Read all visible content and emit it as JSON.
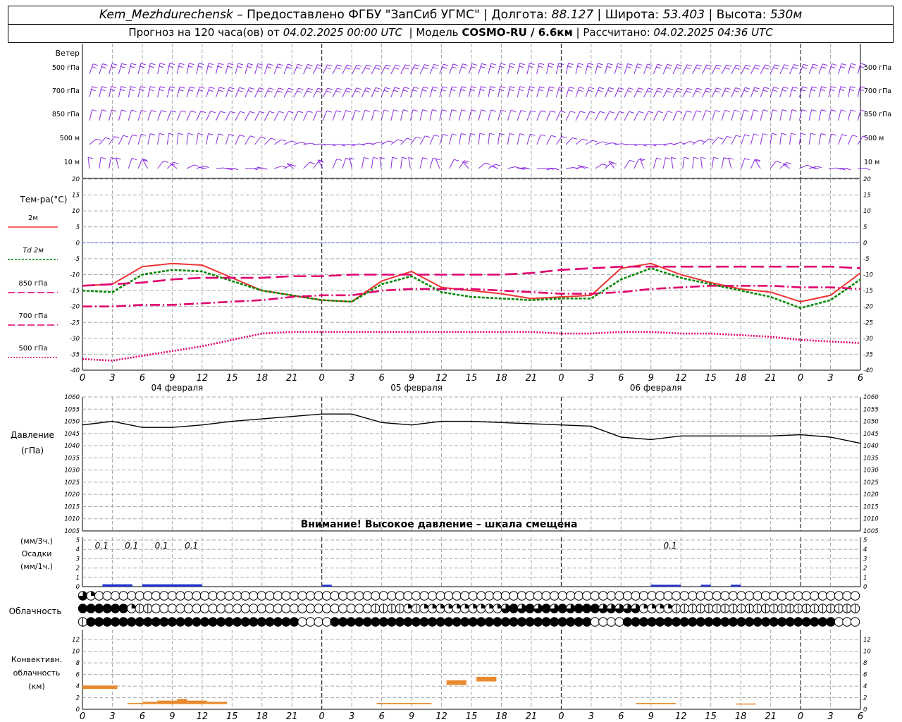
{
  "header": {
    "station": "Kem_Mezhdurechensk",
    "provider": "– Предоставлено ФГБУ \"ЗапСиб УГМС\"",
    "lon_label": "Долгота:",
    "lon": "88.127",
    "lat_label": "Широта:",
    "lat": "53.403",
    "alt_label": "Высота:",
    "alt": "530м",
    "forecast_label": "Прогноз на 120 часа(ов) от",
    "forecast_start": "04.02.2025 00:00 UTC",
    "model_label": "Модель",
    "model": "COSMO-RU / 6.6км",
    "calc_label": "Рассчитано:",
    "calc_time": "04.02.2025 04:36 UTC"
  },
  "chart_data": [
    {
      "type": "barbs",
      "title": "Ветер",
      "levels": [
        "500 гПа",
        "700 гПа",
        "850 гПа",
        "500 м",
        "10  м"
      ]
    },
    {
      "type": "line",
      "ylabel": "Тем-ра(°C)",
      "ylim": [
        -40,
        20
      ],
      "yticks": [
        20,
        15,
        10,
        5,
        0,
        -5,
        -10,
        -15,
        -20,
        -25,
        -30,
        -35,
        -40
      ],
      "x_ticks": [
        "0",
        "3",
        "6",
        "9",
        "12",
        "15",
        "18",
        "21",
        "0",
        "3",
        "6",
        "9",
        "12",
        "15",
        "18",
        "21",
        "0",
        "3",
        "6",
        "9",
        "12",
        "15",
        "18",
        "21",
        "0",
        "3",
        "6"
      ],
      "dates": [
        "04 февраля",
        "05 февраля",
        "06 февраля"
      ],
      "x_hours": [
        0,
        3,
        6,
        9,
        12,
        15,
        18,
        21,
        24,
        27,
        30,
        33,
        36,
        39,
        42,
        45,
        48,
        51,
        54,
        57,
        60,
        63,
        66,
        69,
        72,
        75,
        78
      ],
      "series": [
        {
          "name": "2м",
          "color": "#ee3333",
          "dash": "",
          "values": [
            -13.5,
            -13,
            -7.5,
            -6.5,
            -7,
            -11,
            -15,
            -16.5,
            -18,
            -18.5,
            -12,
            -9,
            -14,
            -15,
            -16,
            -17.5,
            -17,
            -16.5,
            -8,
            -6.5,
            -10,
            -12.5,
            -14.5,
            -15.5,
            -18.5,
            -16.5,
            -9.5
          ]
        },
        {
          "name": "Td  2м",
          "color": "#008800",
          "dash": "4,2",
          "values": [
            -15,
            -15.5,
            -10,
            -8.5,
            -9,
            -12,
            -15,
            -16.5,
            -18,
            -18.5,
            -13,
            -10.5,
            -15.5,
            -17,
            -17.5,
            -18,
            -17.5,
            -17.5,
            -11.5,
            -8,
            -11,
            -13,
            -15,
            -17,
            -20.5,
            -18,
            -11.5
          ]
        },
        {
          "name": "850 гПа",
          "color": "#e0006f",
          "dash": "18,7",
          "values": [
            -13.5,
            -13,
            -12.5,
            -11.5,
            -11,
            -11,
            -11,
            -10.5,
            -10.5,
            -10,
            -10,
            -10,
            -10,
            -10,
            -10,
            -9.5,
            -8.5,
            -8,
            -7.5,
            -7.5,
            -7.5,
            -7.5,
            -7.5,
            -7.5,
            -7.5,
            -7.5,
            -8
          ]
        },
        {
          "name": "700 гПа",
          "color": "#e0006f",
          "dash": "14,4,2,4",
          "values": [
            -20,
            -20,
            -19.5,
            -19.5,
            -19,
            -18.5,
            -18,
            -17,
            -16.5,
            -16.5,
            -15,
            -14.5,
            -14.5,
            -14.5,
            -15,
            -15.5,
            -16,
            -16,
            -15.5,
            -14.5,
            -14,
            -13.5,
            -13.5,
            -13.5,
            -14,
            -14,
            -14.5
          ]
        },
        {
          "name": "500 гПа",
          "color": "#e0006f",
          "dash": "2,2",
          "values": [
            -36.5,
            -37,
            -35.5,
            -34,
            -32.5,
            -30.5,
            -28.5,
            -28,
            -28,
            -28,
            -28,
            -28,
            -28,
            -28,
            -28,
            -28,
            -28.5,
            -28.5,
            -28,
            -28,
            -28.5,
            -28.5,
            -29,
            -29.5,
            -30.5,
            -31,
            -31.5
          ]
        }
      ]
    },
    {
      "type": "line",
      "ylabel": "Давление",
      "ylabel2": "(гПа)",
      "ylim": [
        1005,
        1060
      ],
      "yticks": [
        1060,
        1055,
        1050,
        1045,
        1040,
        1035,
        1030,
        1025,
        1020,
        1015,
        1010,
        1005
      ],
      "note": "Внимание! Высокое давление – шкала смещена",
      "x_hours": [
        0,
        3,
        6,
        9,
        12,
        15,
        18,
        21,
        24,
        27,
        30,
        33,
        36,
        39,
        42,
        45,
        48,
        51,
        54,
        57,
        60,
        63,
        66,
        69,
        72,
        75,
        78
      ],
      "values": [
        1048.5,
        1050,
        1047.5,
        1047.5,
        1048.5,
        1050,
        1051,
        1052,
        1053,
        1053,
        1049.5,
        1048.5,
        1050,
        1050,
        1049.5,
        1049,
        1048.5,
        1048,
        1043.5,
        1042.5,
        1044,
        1044,
        1044,
        1044,
        1044.5,
        1043.5,
        1041
      ]
    },
    {
      "type": "bar",
      "ylabel": "(мм/3ч.)",
      "ylabel2": "Осадки",
      "ylabel3": "(мм/1ч.)",
      "ylim": [
        0,
        5
      ],
      "yticks": [
        5,
        4,
        3,
        2,
        1,
        0
      ],
      "labels": [
        {
          "hour": 1.5,
          "text": "0.1"
        },
        {
          "hour": 4.5,
          "text": "0.1"
        },
        {
          "hour": 7.5,
          "text": "0.1"
        },
        {
          "hour": 10.5,
          "text": "0.1"
        },
        {
          "hour": 58.5,
          "text": "0.1"
        }
      ],
      "bars": [
        {
          "from": 2,
          "to": 5,
          "value": 0.1
        },
        {
          "from": 6,
          "to": 12,
          "value": 0.1
        },
        {
          "from": 24,
          "to": 25,
          "value": 0.05
        },
        {
          "from": 57,
          "to": 60,
          "value": 0.05
        },
        {
          "from": 62,
          "to": 63,
          "value": 0.05
        },
        {
          "from": 65,
          "to": 66,
          "value": 0.05
        }
      ]
    },
    {
      "type": "table",
      "title": "Облачность",
      "rows": [
        "32000000000000000000000000000000000000000000000000000000000000000000000000000000000000000000000000000000000000000000000111111111111111123433",
        "44444421100000000000000000000000000011112122222222223434343434443333322221111111111111111111111111111111000000000000111121222211223333343432",
        "14444444444444444444444444400004444444444444444444444444444444400004444444444444444444444444400000000000000000000000000000000000000000000000"
      ]
    },
    {
      "type": "bar",
      "ylabel": "Конвективн.",
      "ylabel2": "облачность",
      "ylabel3": "(км)",
      "ylim": [
        0,
        13
      ],
      "yticks": [
        12,
        10,
        8,
        6,
        4,
        2,
        0
      ],
      "bars": [
        {
          "from": 0,
          "to": 3.5,
          "bottom": 3.5,
          "top": 4.1
        },
        {
          "from": 4.5,
          "to": 6,
          "bottom": 0.9,
          "top": 1.1
        },
        {
          "from": 6,
          "to": 7.5,
          "bottom": 0.9,
          "top": 1.3
        },
        {
          "from": 7.5,
          "to": 9.5,
          "bottom": 0.9,
          "top": 1.5
        },
        {
          "from": 9.5,
          "to": 10.5,
          "bottom": 0.9,
          "top": 1.8
        },
        {
          "from": 10.5,
          "to": 12.5,
          "bottom": 0.9,
          "top": 1.5
        },
        {
          "from": 12.5,
          "to": 14.5,
          "bottom": 0.9,
          "top": 1.3
        },
        {
          "from": 29.5,
          "to": 35,
          "bottom": 0.9,
          "top": 1.1
        },
        {
          "from": 36.5,
          "to": 38.5,
          "bottom": 4.2,
          "top": 5.0
        },
        {
          "from": 39.5,
          "to": 41.5,
          "bottom": 4.8,
          "top": 5.6
        },
        {
          "from": 55.5,
          "to": 59.5,
          "bottom": 0.9,
          "top": 1.1
        },
        {
          "from": 65.5,
          "to": 67.5,
          "bottom": 0.9,
          "top": 1.0
        }
      ]
    }
  ]
}
